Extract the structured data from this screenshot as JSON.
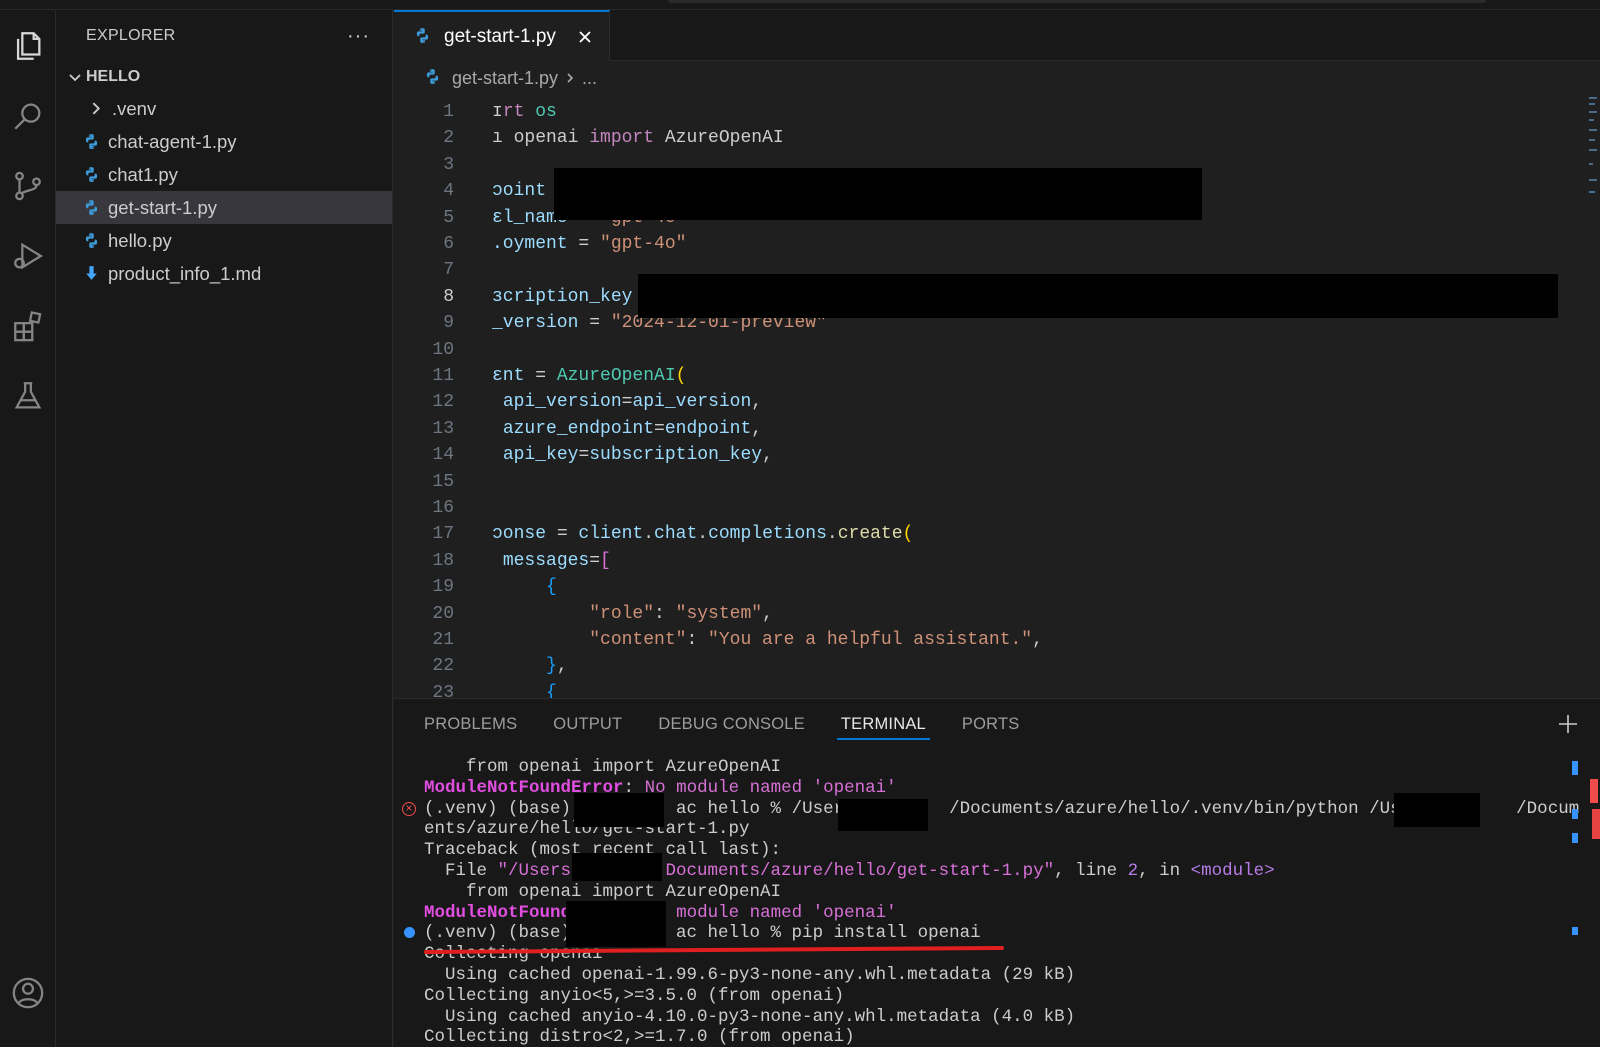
{
  "colors": {
    "accent": "#0078d4",
    "error": "#f14c4c",
    "python_icon": "#3c9bd8",
    "markdown_icon": "#42a5f5"
  },
  "activity_bar": {
    "icons": [
      "files-icon",
      "search-icon",
      "source-control-icon",
      "run-debug-icon",
      "extensions-icon",
      "testing-icon",
      "account-icon"
    ]
  },
  "explorer": {
    "title": "EXPLORER",
    "more": "···",
    "section": "HELLO",
    "items": [
      {
        "label": ".venv",
        "kind": "folder"
      },
      {
        "label": "chat-agent-1.py",
        "kind": "python"
      },
      {
        "label": "chat1.py",
        "kind": "python"
      },
      {
        "label": "get-start-1.py",
        "kind": "python",
        "selected": true
      },
      {
        "label": "hello.py",
        "kind": "python"
      },
      {
        "label": "product_info_1.md",
        "kind": "markdown"
      }
    ]
  },
  "editor": {
    "tab": {
      "label": "get-start-1.py"
    },
    "breadcrumb": {
      "file": "get-start-1.py",
      "rest": "..."
    },
    "current_line": 8,
    "lines": [
      {
        "n": "1",
        "tokens": [
          [
            "pl",
            "ɪ"
          ],
          [
            "kw",
            "rt "
          ],
          [
            "mod",
            "os"
          ]
        ]
      },
      {
        "n": "2",
        "tokens": [
          [
            "pl",
            "ı openai "
          ],
          [
            "kw",
            "import "
          ],
          [
            "pl",
            "AzureOpenAI"
          ]
        ]
      },
      {
        "n": "3",
        "tokens": []
      },
      {
        "n": "4",
        "tokens": [
          [
            "var",
            "ɔoint"
          ],
          [
            "pl",
            " ="
          ]
        ]
      },
      {
        "n": "5",
        "tokens": [
          [
            "var",
            "ɛl_name"
          ],
          [
            "pl",
            " = "
          ],
          [
            "str",
            "\"gpt-4o\""
          ]
        ]
      },
      {
        "n": "6",
        "tokens": [
          [
            "var",
            ".oyment"
          ],
          [
            "pl",
            " = "
          ],
          [
            "str",
            "\"gpt-4o\""
          ]
        ]
      },
      {
        "n": "7",
        "tokens": []
      },
      {
        "n": "8",
        "tokens": [
          [
            "var",
            "ɜcription_key"
          ],
          [
            "pl",
            " ="
          ]
        ]
      },
      {
        "n": "9",
        "tokens": [
          [
            "var",
            "_version"
          ],
          [
            "pl",
            " = "
          ],
          [
            "str",
            "\"2024-12-01-preview\""
          ]
        ]
      },
      {
        "n": "10",
        "tokens": []
      },
      {
        "n": "11",
        "tokens": [
          [
            "var",
            "ɛnt"
          ],
          [
            "pl",
            " = "
          ],
          [
            "mod",
            "AzureOpenAI"
          ],
          [
            "br1",
            "("
          ]
        ]
      },
      {
        "n": "12",
        "tokens": [
          [
            "pl",
            " "
          ],
          [
            "var",
            "api_version"
          ],
          [
            "pl",
            "="
          ],
          [
            "var",
            "api_version"
          ],
          [
            "pl",
            ","
          ]
        ]
      },
      {
        "n": "13",
        "tokens": [
          [
            "pl",
            " "
          ],
          [
            "var",
            "azure_endpoint"
          ],
          [
            "pl",
            "="
          ],
          [
            "var",
            "endpoint"
          ],
          [
            "pl",
            ","
          ]
        ]
      },
      {
        "n": "14",
        "tokens": [
          [
            "pl",
            " "
          ],
          [
            "var",
            "api_key"
          ],
          [
            "pl",
            "="
          ],
          [
            "var",
            "subscription_key"
          ],
          [
            "pl",
            ","
          ]
        ]
      },
      {
        "n": "15",
        "tokens": []
      },
      {
        "n": "16",
        "tokens": []
      },
      {
        "n": "17",
        "tokens": [
          [
            "var",
            "ɔonse"
          ],
          [
            "pl",
            " = "
          ],
          [
            "var",
            "client"
          ],
          [
            "pl",
            "."
          ],
          [
            "var",
            "chat"
          ],
          [
            "pl",
            "."
          ],
          [
            "var",
            "completions"
          ],
          [
            "pl",
            "."
          ],
          [
            "fn",
            "create"
          ],
          [
            "br1",
            "("
          ]
        ]
      },
      {
        "n": "18",
        "tokens": [
          [
            "pl",
            " "
          ],
          [
            "var",
            "messages"
          ],
          [
            "pl",
            "="
          ],
          [
            "br2",
            "["
          ]
        ]
      },
      {
        "n": "19",
        "tokens": [
          [
            "pl",
            "     "
          ],
          [
            "br3",
            "{"
          ]
        ]
      },
      {
        "n": "20",
        "tokens": [
          [
            "pl",
            "         "
          ],
          [
            "str",
            "\"role\""
          ],
          [
            "pl",
            ": "
          ],
          [
            "str",
            "\"system\""
          ],
          [
            "pl",
            ","
          ]
        ]
      },
      {
        "n": "21",
        "tokens": [
          [
            "pl",
            "         "
          ],
          [
            "str",
            "\"content\""
          ],
          [
            "pl",
            ": "
          ],
          [
            "str",
            "\"You are a helpful assistant.\""
          ],
          [
            "pl",
            ","
          ]
        ]
      },
      {
        "n": "22",
        "tokens": [
          [
            "pl",
            "     "
          ],
          [
            "br3",
            "}"
          ],
          [
            "pl",
            ","
          ]
        ]
      },
      {
        "n": "23",
        "tokens": [
          [
            "pl",
            "     "
          ],
          [
            "br3",
            "{"
          ]
        ]
      }
    ]
  },
  "panel": {
    "tabs": [
      {
        "label": "PROBLEMS"
      },
      {
        "label": "OUTPUT"
      },
      {
        "label": "DEBUG CONSOLE"
      },
      {
        "label": "TERMINAL",
        "active": true
      },
      {
        "label": "PORTS"
      }
    ],
    "terminal": [
      {
        "tokens": [
          [
            "pl",
            "    from openai import AzureOpenAI"
          ]
        ]
      },
      {
        "tokens": [
          [
            "err",
            "ModuleNotFoundError"
          ],
          [
            "pl",
            ": "
          ],
          [
            "errtxt",
            "No module named 'openai'"
          ]
        ]
      },
      {
        "gutter": "err",
        "tokens": [
          [
            "pl",
            "(.venv) (base) "
          ],
          [
            "pl",
            "         ac hello % /Users         /Documents/azure/hello/.venv/bin/python /Users        /Docum"
          ]
        ]
      },
      {
        "tokens": [
          [
            "pl",
            "ents/azure/hello/get-start-1.py"
          ]
        ]
      },
      {
        "tokens": [
          [
            "pl",
            "Traceback (most recent call last):"
          ]
        ]
      },
      {
        "tokens": [
          [
            "pl",
            "  File "
          ],
          [
            "path",
            "\"/Users,        Documents/azure/hello/get-start-1.py\""
          ],
          [
            "pl",
            ", line "
          ],
          [
            "num",
            "2"
          ],
          [
            "pl",
            ", in "
          ],
          [
            "mod2",
            "<module>"
          ]
        ]
      },
      {
        "tokens": [
          [
            "pl",
            "    from openai import AzureOpenAI"
          ]
        ]
      },
      {
        "tokens": [
          [
            "err",
            "ModuleNotFoundError"
          ],
          [
            "pl",
            ": "
          ],
          [
            "errtxt",
            "No module named 'openai'"
          ]
        ]
      },
      {
        "gutter": "ok",
        "tokens": [
          [
            "pl",
            "(.venv) (base)          ac hello % pip install openai"
          ]
        ]
      },
      {
        "tokens": [
          [
            "pl",
            "Collecting openai"
          ]
        ]
      },
      {
        "tokens": [
          [
            "pl",
            "  Using cached openai-1.99.6-py3-none-any.whl.metadata (29 kB)"
          ]
        ]
      },
      {
        "tokens": [
          [
            "pl",
            "Collecting anyio<5,>=3.5.0 (from openai)"
          ]
        ]
      },
      {
        "tokens": [
          [
            "pl",
            "  Using cached anyio-4.10.0-py3-none-any.whl.metadata (4.0 kB)"
          ]
        ]
      },
      {
        "tokens": [
          [
            "pl",
            "Collecting distro<2,>=1.7.0 (from openai)"
          ]
        ]
      }
    ]
  }
}
